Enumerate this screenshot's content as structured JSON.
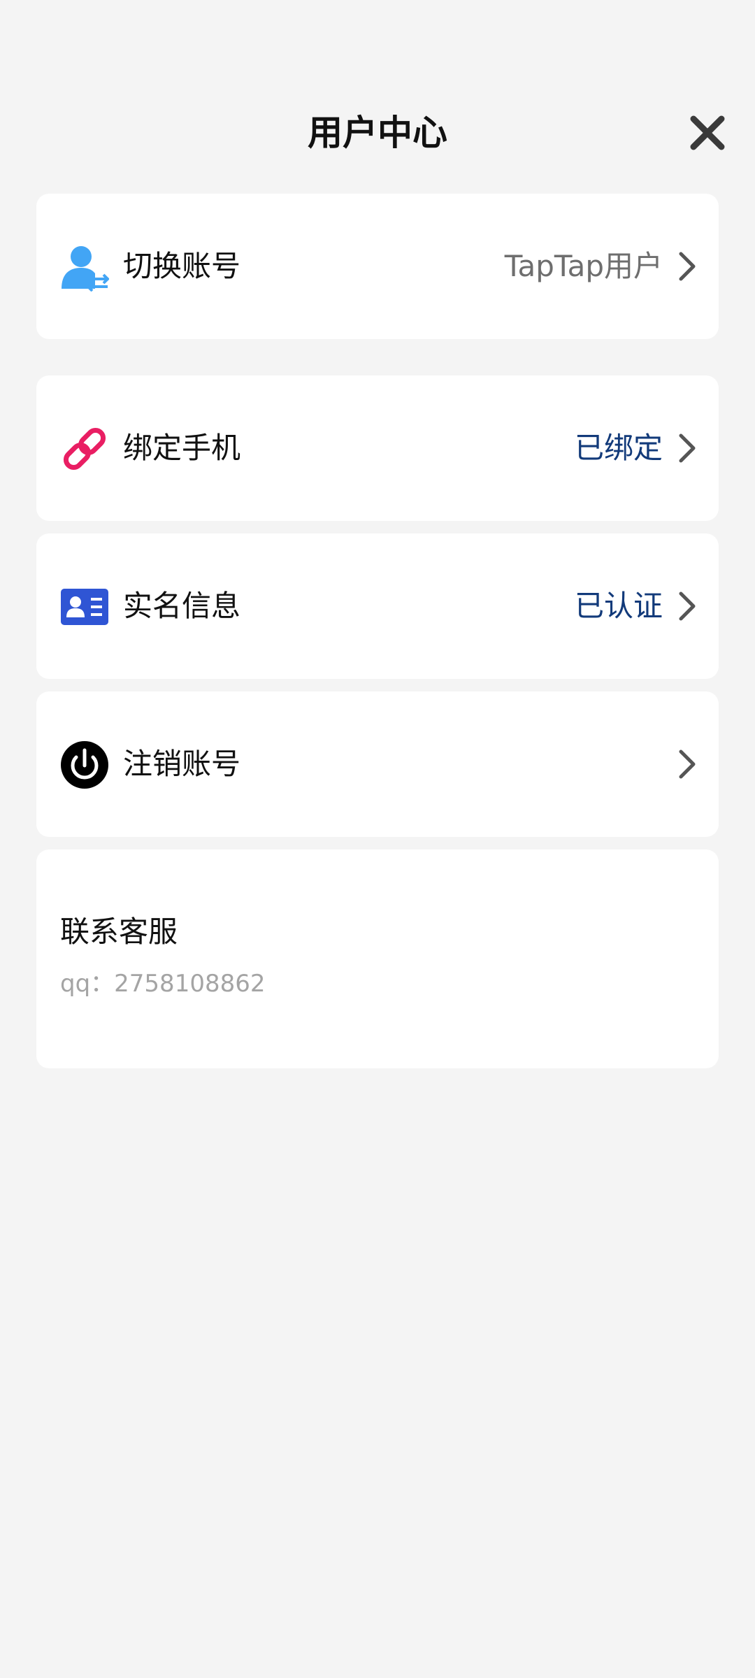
{
  "header": {
    "title": "用户中心"
  },
  "rows": [
    {
      "icon": "user-switch-icon",
      "label": "切换账号",
      "value": "TapTap用户"
    },
    {
      "icon": "link-icon",
      "label": "绑定手机",
      "value": "已绑定"
    },
    {
      "icon": "id-card-icon",
      "label": "实名信息",
      "value": "已认证"
    },
    {
      "icon": "power-icon",
      "label": "注销账号",
      "value": ""
    }
  ],
  "contact": {
    "title": "联系客服",
    "qq": "qq：2758108862"
  },
  "colors": {
    "background": "#f4f4f4",
    "card": "#ffffff",
    "value_blue": "#123a7a",
    "value_gray": "#6e6e6e",
    "user_icon": "#42a5f5",
    "link_icon": "#e91e63",
    "id_card_icon": "#2f55d4",
    "power_icon": "#000000"
  }
}
